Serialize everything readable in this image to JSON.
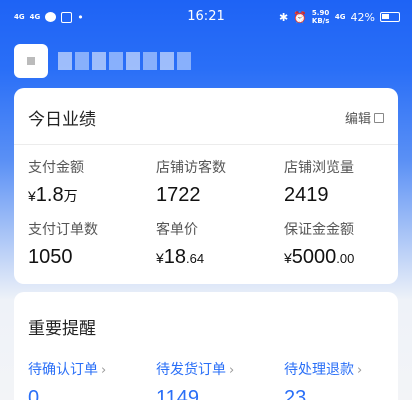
{
  "status_bar": {
    "network1": "4G",
    "network2": "4G",
    "time": "16:21",
    "speed": "5.90 KB/s",
    "battery": "42%"
  },
  "performance": {
    "title": "今日业绩",
    "edit_label": "编辑",
    "metrics": [
      {
        "label": "支付金额",
        "currency": "¥",
        "main": "1.8",
        "suffix": "万"
      },
      {
        "label": "店铺访客数",
        "currency": "",
        "main": "1722",
        "suffix": ""
      },
      {
        "label": "店铺浏览量",
        "currency": "",
        "main": "2419",
        "suffix": ""
      },
      {
        "label": "支付订单数",
        "currency": "",
        "main": "1050",
        "suffix": ""
      },
      {
        "label": "客单价",
        "currency": "¥",
        "main": "18",
        "suffix": ".64"
      },
      {
        "label": "保证金金额",
        "currency": "¥",
        "main": "5000",
        "suffix": ".00"
      }
    ]
  },
  "reminders": {
    "title": "重要提醒",
    "items": [
      {
        "label": "待确认订单",
        "value": "0"
      },
      {
        "label": "待发货订单",
        "value": "1149"
      },
      {
        "label": "待处理退款",
        "value": "23"
      }
    ]
  },
  "colors": {
    "brand_blue": "#2a6ff7"
  }
}
